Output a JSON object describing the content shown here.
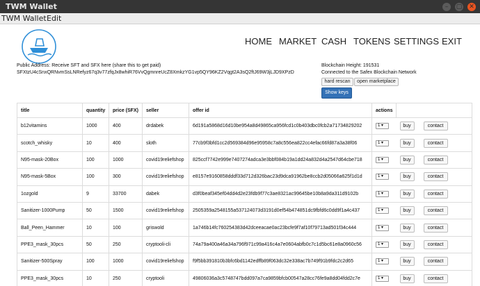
{
  "window": {
    "title": "TWM Wallet"
  },
  "window_controls": {
    "minimize": "–",
    "maximize": "▢",
    "close": "✕"
  },
  "menubar": [
    "TWM Wallet",
    "Edit"
  ],
  "nav": [
    "HOME",
    "MARKET",
    "CASH",
    "TOKENS",
    "SETTINGS",
    "EXIT"
  ],
  "account": {
    "public_address_label": "Public Address: Receive SFT and SFX here (share this to get paid)",
    "public_address": "SFXtzU4cSnxQRNvmSsLNRefyz67q3v77zfqJx8whiR76VvQgmnreUcZ8XmkzYG1vp5QY96KZ2Vqgt2A3sQ2ftJ69W3jLJD9XPzD"
  },
  "chain": {
    "height_label": "Blockchain Height: 191531",
    "status": "Connected to the Safex Blockchain Network"
  },
  "buttons": {
    "hard_rescan": "hard rescan",
    "open_marketplace": "open marketplace",
    "show_keys": "Show keys"
  },
  "colors": {
    "primary_button": "#3371b6",
    "logo": "#2f8fd8",
    "close_button": "#e95420"
  },
  "table": {
    "headers": [
      "title",
      "quantity",
      "price (SFX)",
      "seller",
      "offer id",
      "actions"
    ],
    "action_labels": {
      "qty_select": "1 ▾",
      "buy": "buy",
      "contact": "contact"
    },
    "rows": [
      {
        "title": "b12vitamins",
        "quantity": "1000",
        "price": "400",
        "seller": "drdabek",
        "offer_id": "6d191a5868d16d10be954a8d49865ca956fcd1c0b403dbc0fcb2a71734829202"
      },
      {
        "title": "scotch_whisky",
        "quantity": "10",
        "price": "400",
        "seller": "sloth",
        "offer_id": "77cb9f3bfd1cc2d569384d96e95958c7a8c556ea822cc4efac66fd87a3a38f06"
      },
      {
        "title": "N95-mask-20Box",
        "quantity": "100",
        "price": "1000",
        "seller": "covid19reliefshop",
        "offer_id": "825ccf7742e999e7407274adca3e3bbf084b19a1dd24a832d4a2547d64cbe718"
      },
      {
        "title": "N95-mask-5Box",
        "quantity": "100",
        "price": "300",
        "seller": "covid19reliefshop",
        "offer_id": "e8157e9160858dddf33d712d326bac23d9dca91962be8ccb2d05066a625f1d1d"
      },
      {
        "title": "1ozgold",
        "quantity": "9",
        "price": "33700",
        "seller": "dabek",
        "offer_id": "d3f0beaf345ef04dd4d2e23fdb9f77c3ae8321ac99645be10b8a9da311d9102b"
      },
      {
        "title": "Sanitizer-1000Pump",
        "quantity": "50",
        "price": "1500",
        "seller": "covid19reliefshop",
        "offer_id": "2505359a2548155a537124073d3191d0ef54b474851dc9fbfd6c0dd9f1a4c437"
      },
      {
        "title": "Ball_Peen_Hammer",
        "quantity": "10",
        "price": "100",
        "seller": "griswold",
        "offer_id": "1a746b14fc760254383d42dceeacae0ac23bcfe9f7af10f79713ad501f34c444"
      },
      {
        "title": "PPE3_mask_30pcs",
        "quantity": "50",
        "price": "250",
        "seller": "cryptooli-cli",
        "offer_id": "74a79a400a46a34a796f971c99a416c4a7e0604abfb0c7c1d5bc61e8a0960c56"
      },
      {
        "title": "Sanitizer-500Spray",
        "quantity": "100",
        "price": "1000",
        "seller": "covid19reliefshop",
        "offer_id": "f9f5bb391810b3bfc6bd1142edffb89f063dc32e338ac7b749f91b9fdc2c2d65"
      },
      {
        "title": "PPE3_mask_30pcs",
        "quantity": "10",
        "price": "250",
        "seller": "cryptooli",
        "offer_id": "49806036a3c5748747bdd097a7ca9859bfcb00547a28cc76fe9a8dd04fdd2c7e"
      }
    ]
  }
}
